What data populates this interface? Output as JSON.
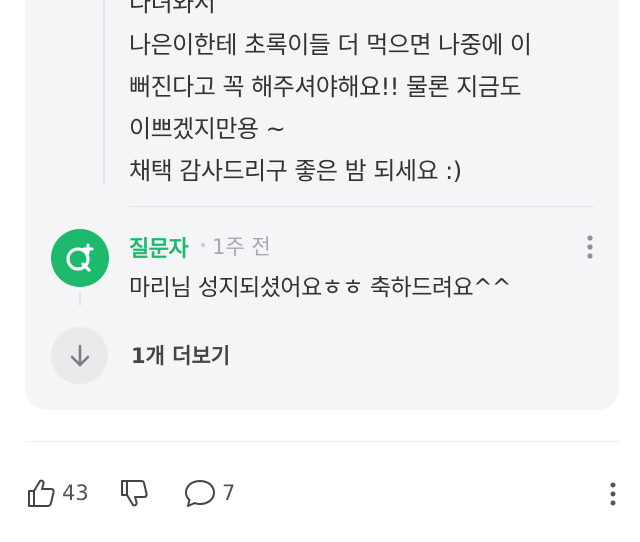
{
  "reply": {
    "lines": [
      "다녀와서",
      "나은이한테 초록이들 더 먹으면 나중에 이",
      "뻐진다고 꼭 해주셔야해요!! 물론 지금도",
      "이쁘겠지만용 ~",
      "채택 감사드리구 좋은 밤 되세요 :)"
    ]
  },
  "comment": {
    "author": "질문자",
    "time": "1주 전",
    "text": "마리님 성지되셨어요ㅎㅎ 축하드려요^^",
    "avatar_icon": "question-mark-plus-icon",
    "accent_color": "#1dba6e"
  },
  "load_more": {
    "label": "1개 더보기",
    "icon": "arrow-down-icon"
  },
  "actions": {
    "like_count": "43",
    "comment_count": "7"
  }
}
